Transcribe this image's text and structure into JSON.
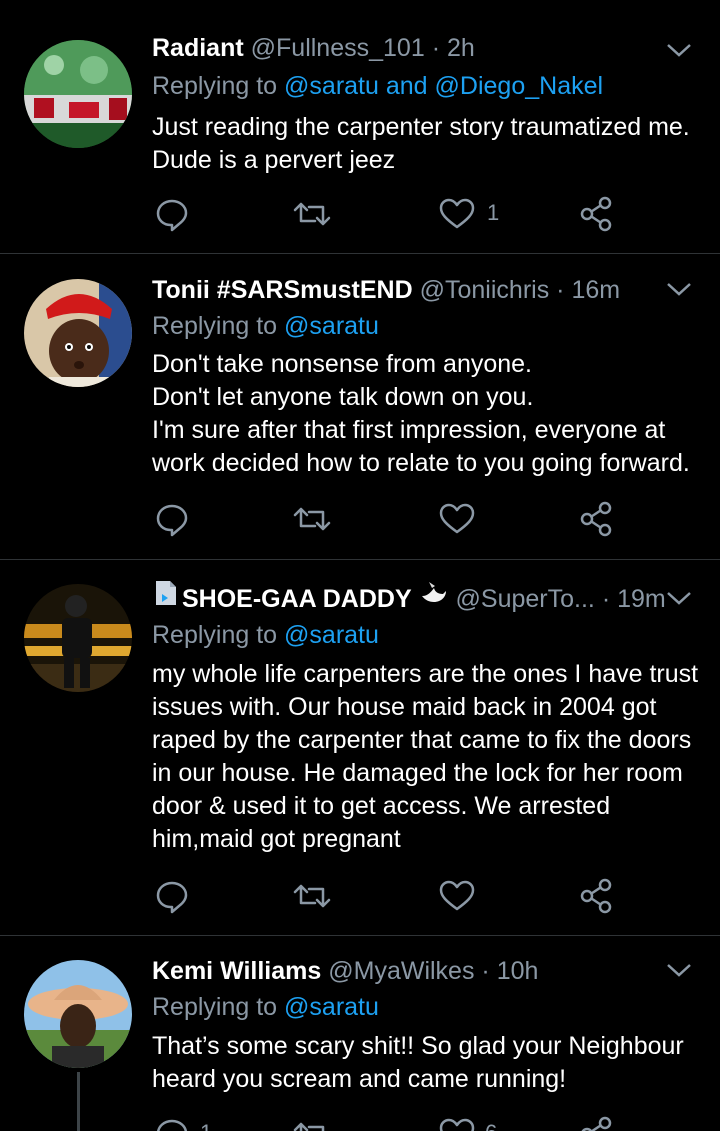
{
  "icons": {
    "reply": "reply-icon",
    "retweet": "retweet-icon",
    "like": "heart-icon",
    "share": "share-icon",
    "menu": "chevron-down-icon"
  },
  "colors": {
    "background": "#000000",
    "text": "#ffffff",
    "muted": "#8b98a5",
    "accent": "#1da1f2",
    "divider": "#2f3336"
  },
  "tweets": [
    {
      "name": "Radiant",
      "handle": "@Fullness_101",
      "time": "2h",
      "reply_prefix": "Replying to",
      "mention1": "@saratu",
      "reply_and": "and",
      "mention2": "@Diego_Nakel",
      "lines": [
        "Just reading the carpenter story traumatized me.",
        "Dude is a pervert jeez"
      ],
      "likes": "1"
    },
    {
      "name": "Tonii #SARSmustEND",
      "handle": "@Toniichris",
      "time": "16m",
      "reply_prefix": "Replying to",
      "mention1": "@saratu",
      "lines": [
        "Don't take nonsense from anyone.",
        "Don't let anyone talk down on you.",
        "I'm sure after that first impression, everyone at",
        "work decided how to relate to you going forward."
      ]
    },
    {
      "name": "SHOE-GAA DADDY",
      "handle": "@SuperTo...",
      "time": "19m",
      "reply_prefix": "Replying to",
      "mention1": "@saratu",
      "lines": [
        "my whole life carpenters are the ones I have trust",
        "issues with. Our house maid back in 2004 got",
        "raped by the carpenter that came to fix the doors",
        "in our house. He damaged the lock for her room",
        "door & used it to get access. We arrested",
        "him,maid got pregnant"
      ]
    },
    {
      "name": "Kemi Williams",
      "handle": "@MyaWilkes",
      "time": "10h",
      "reply_prefix": "Replying to",
      "mention1": "@saratu",
      "lines": [
        "That’s some scary shit!! So glad your Neighbour",
        "heard you scream and came running!"
      ],
      "replies": "1",
      "likes": "6"
    }
  ]
}
